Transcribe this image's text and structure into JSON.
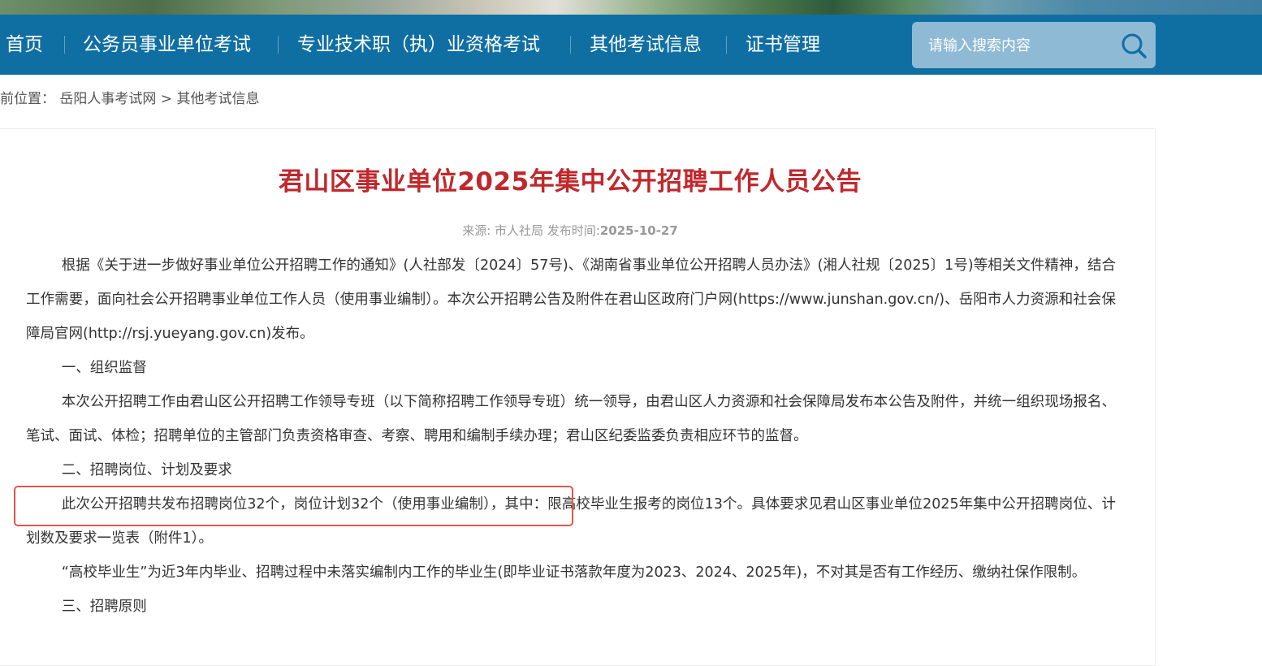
{
  "nav": {
    "items": [
      "首页",
      "公务员事业单位考试",
      "专业技术职（执）业资格考试",
      "其他考试信息",
      "证书管理"
    ],
    "search_placeholder": "请输入搜索内容",
    "bg_color": "#0f6fa3"
  },
  "breadcrumb": {
    "prefix": "前位置：",
    "home": "岳阳人事考试网",
    "sep": " > ",
    "current": "其他考试信息"
  },
  "article": {
    "title": "君山区事业单位2025年集中公开招聘工作人员公告",
    "source_label": "来源: ",
    "source": "市人社局",
    "date_label": " 发布时间:",
    "date": "2025-10-27",
    "paragraphs": [
      "根据《关于进一步做好事业单位公开招聘工作的通知》(人社部发〔2024〕57号)、《湖南省事业单位公开招聘人员办法》(湘人社规〔2025〕1号)等相关文件精神，结合工作需要，面向社会公开招聘事业单位工作人员（使用事业编制）。本次公开招聘公告及附件在君山区政府门户网(https://www.junshan.gov.cn/)、岳阳市人力资源和社会保障局官网(http://rsj.yueyang.gov.cn)发布。",
      "一、组织监督",
      "本次公开招聘工作由君山区公开招聘工作领导专班（以下简称招聘工作领导专班）统一领导，由君山区人力资源和社会保障局发布本公告及附件，并统一组织现场报名、笔试、面试、体检；招聘单位的主管部门负责资格审查、考察、聘用和编制手续办理；君山区纪委监委负责相应环节的监督。",
      "二、招聘岗位、计划及要求",
      "此次公开招聘共发布招聘岗位32个，岗位计划32个（使用事业编制），其中：限高校毕业生报考的岗位13个。具体要求见君山区事业单位2025年集中公开招聘岗位、计划数及要求一览表（附件1）。",
      "“高校毕业生”为近3年内毕业、招聘过程中未落实编制内工作的毕业生(即毕业证书落款年度为2023、2024、2025年)，不对其是否有工作经历、缴纳社保作限制。",
      "三、招聘原则"
    ],
    "title_color": "#c0282d",
    "highlight_color": "#e8524a"
  }
}
